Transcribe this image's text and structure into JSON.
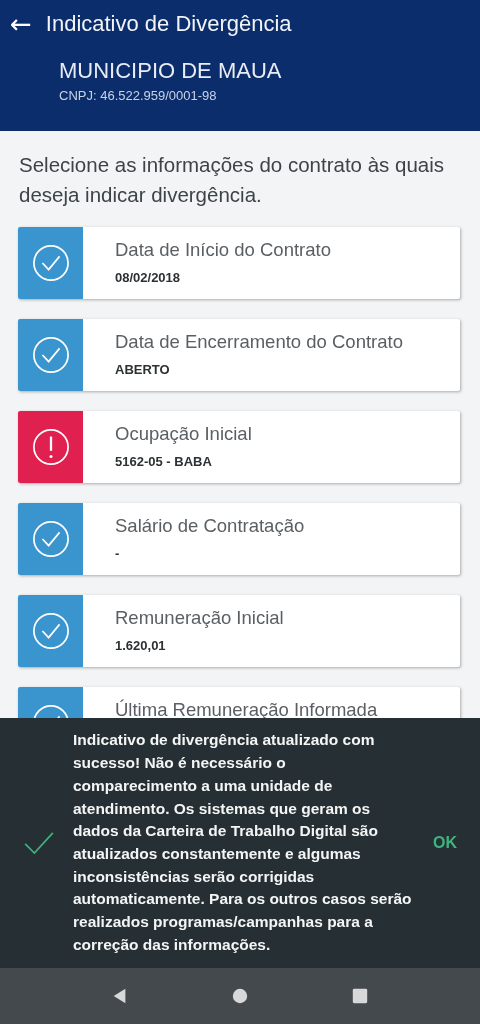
{
  "app_bar": {
    "back_icon": "←",
    "title": "Indicativo de Divergência",
    "employer": "MUNICIPIO DE MAUA",
    "cnpj": "CNPJ: 46.522.959/0001-98"
  },
  "instruction": "Selecione as informações do contrato às quais deseja indicar divergência.",
  "items": [
    {
      "kind": "ok",
      "title": "Data de Início do Contrato",
      "value": "08/02/2018"
    },
    {
      "kind": "ok",
      "title": "Data de Encerramento do Contrato",
      "value": "ABERTO"
    },
    {
      "kind": "divergent",
      "title": "Ocupação Inicial",
      "value": "5162-05 - BABA"
    },
    {
      "kind": "ok",
      "title": "Salário de Contratação",
      "value": "-"
    },
    {
      "kind": "ok",
      "title": "Remuneração Inicial",
      "value": "1.620,01"
    },
    {
      "kind": "ok",
      "title": "Última Remuneração Informada"
    }
  ],
  "snackbar": {
    "message": "Indicativo de divergência atualizado com sucesso! Não é necessário o comparecimento a uma unidade de atendimento. Os sistemas que geram os dados da Carteira de Trabalho Digital são atualizados constantemente e algumas inconsistências serão corrigidas automaticamente. Para os outros casos serão realizados programas/campanhas para a correção das informações.",
    "action": "OK"
  }
}
